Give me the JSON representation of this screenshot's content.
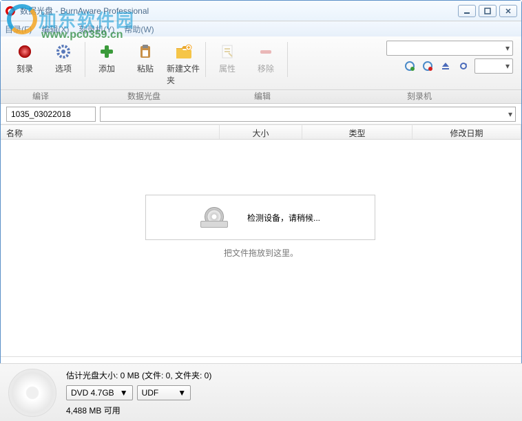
{
  "window": {
    "title": "数据光盘 - BurnAware Professional"
  },
  "menu": {
    "file": "目录(F)",
    "edit": "编辑(X)",
    "recorder": "刻录机(Y)",
    "help": "帮助(W)"
  },
  "toolbar": {
    "burn": "刻录",
    "options": "选项",
    "add": "添加",
    "paste": "粘贴",
    "newfolder": "新建文件夹",
    "properties": "属性",
    "remove": "移除"
  },
  "groups": {
    "compile": "编译",
    "datadisc": "数据光盘",
    "edit": "编辑",
    "recorder": "刻录机"
  },
  "disc": {
    "name": "1035_03022018"
  },
  "columns": {
    "name": "名称",
    "size": "大小",
    "type": "类型",
    "date": "修改日期"
  },
  "message": {
    "detecting": "检测设备，请稍候...",
    "dragdrop": "把文件拖放到这里。"
  },
  "footer": {
    "estimate": "估计光盘大小: 0 MB (文件: 0, 文件夹: 0)",
    "discsize": "DVD 4.7GB",
    "filesystem": "UDF",
    "available": "4,488 MB 可用"
  },
  "watermark": {
    "brand": "加东软件园",
    "url": "www.pc0359.cn"
  }
}
